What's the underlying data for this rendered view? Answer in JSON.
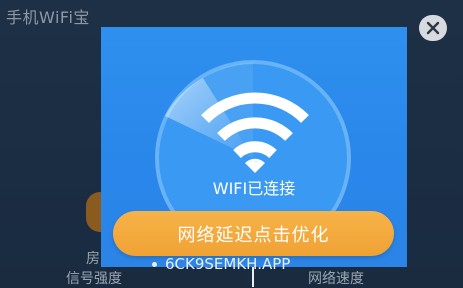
{
  "background": {
    "app_title": "手机WiFi宝",
    "label_left_top": "房",
    "label_left_bottom": "信号强度",
    "label_right_bottom": "网络速度"
  },
  "popup": {
    "ssid_dash": "--",
    "status_text": "WIFI已连接",
    "optimize_button_label": "网络延迟点击优化",
    "network_name": "6CK9SEMKH.APP"
  },
  "icons": {
    "wifi": "wifi-icon",
    "close": "close-icon"
  },
  "colors": {
    "popup_blue": "#2e8ff0",
    "button_orange": "#f2a83b"
  }
}
